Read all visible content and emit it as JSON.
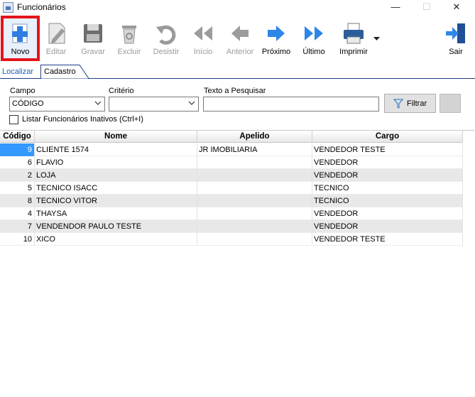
{
  "window": {
    "title": "Funcionários",
    "minimize_glyph": "—",
    "maximize_glyph": "☐",
    "close_glyph": "✕"
  },
  "toolbar": [
    {
      "id": "novo",
      "label": "Novo",
      "icon": "plus-doc-icon",
      "enabled": true,
      "highlighted": true
    },
    {
      "id": "editar",
      "label": "Editar",
      "icon": "pencil-icon",
      "enabled": false
    },
    {
      "id": "gravar",
      "label": "Gravar",
      "icon": "floppy-disk-icon",
      "enabled": false
    },
    {
      "id": "excluir",
      "label": "Excluir",
      "icon": "trash-icon",
      "enabled": false
    },
    {
      "id": "desistir",
      "label": "Desistir",
      "icon": "undo-icon",
      "enabled": false
    },
    {
      "id": "inicio",
      "label": "Início",
      "icon": "first-record-icon",
      "enabled": false
    },
    {
      "id": "anterior",
      "label": "Anterior",
      "icon": "previous-record-icon",
      "enabled": false
    },
    {
      "id": "proximo",
      "label": "Próximo",
      "icon": "next-record-icon",
      "enabled": true
    },
    {
      "id": "ultimo",
      "label": "Último",
      "icon": "last-record-icon",
      "enabled": true
    },
    {
      "id": "imprimir",
      "label": "Imprimir",
      "icon": "printer-icon",
      "enabled": true
    },
    {
      "id": "sair",
      "label": "Sair",
      "icon": "exit-door-icon",
      "enabled": true
    }
  ],
  "tabs": {
    "localizar": "Localizar",
    "cadastro": "Cadastro"
  },
  "search": {
    "campo_label": "Campo",
    "campo_value": "CÓDIGO",
    "criterio_label": "Critério",
    "criterio_value": "",
    "texto_label": "Texto a Pesquisar",
    "texto_value": "",
    "filter_button": "Filtrar",
    "inactive_checkbox_label": "Listar Funcionários Inativos (Ctrl+I)",
    "inactive_checked": false
  },
  "grid": {
    "columns": [
      "Código",
      "Nome",
      "Apelido",
      "Cargo"
    ],
    "rows": [
      {
        "codigo": "9",
        "nome": "CLIENTE 1574",
        "apelido": "JR IMOBILIARIA",
        "cargo": "VENDEDOR TESTE",
        "selected": true
      },
      {
        "codigo": "6",
        "nome": "FLAVIO",
        "apelido": "",
        "cargo": "VENDEDOR"
      },
      {
        "codigo": "2",
        "nome": "LOJA",
        "apelido": "",
        "cargo": "VENDEDOR"
      },
      {
        "codigo": "5",
        "nome": "TECNICO ISACC",
        "apelido": "",
        "cargo": "TECNICO"
      },
      {
        "codigo": "8",
        "nome": "TECNICO VITOR",
        "apelido": "",
        "cargo": "TECNICO"
      },
      {
        "codigo": "4",
        "nome": "THAYSA",
        "apelido": "",
        "cargo": "VENDEDOR"
      },
      {
        "codigo": "7",
        "nome": "VENDENDOR PAULO TESTE",
        "apelido": "",
        "cargo": "VENDEDOR"
      },
      {
        "codigo": "10",
        "nome": "XICO",
        "apelido": "",
        "cargo": "VENDEDOR TESTE"
      }
    ]
  },
  "colors": {
    "highlight_border": "#e4141b",
    "selection": "#3399ff",
    "tab_line": "#1d3e88"
  }
}
